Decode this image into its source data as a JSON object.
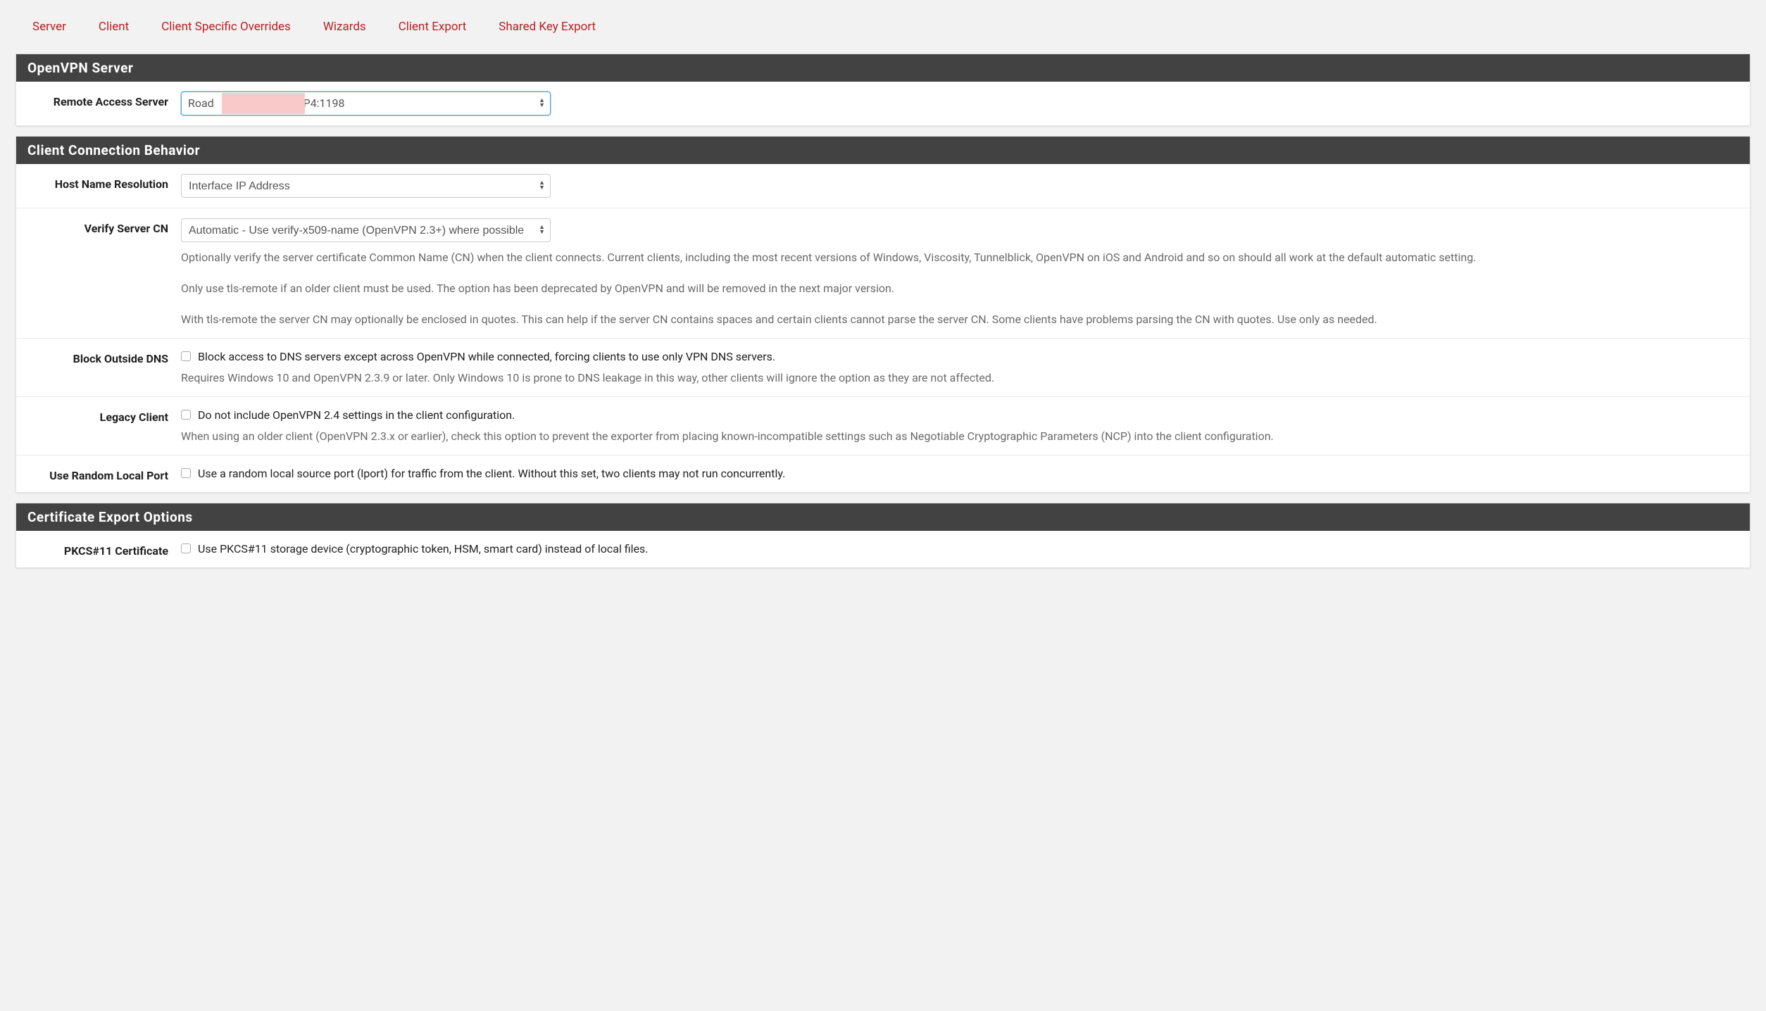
{
  "tabs": [
    {
      "label": "Server"
    },
    {
      "label": "Client"
    },
    {
      "label": "Client Specific Overrides"
    },
    {
      "label": "Wizards"
    },
    {
      "label": "Client Export"
    },
    {
      "label": "Shared Key Export"
    }
  ],
  "panels": {
    "server": {
      "title": "OpenVPN Server",
      "rows": {
        "remote_access": {
          "label": "Remote Access Server",
          "value_prefix": "Road",
          "value_suffix": "UDP4:1198"
        }
      }
    },
    "client_behavior": {
      "title": "Client Connection Behavior",
      "rows": {
        "host_name": {
          "label": "Host Name Resolution",
          "value": "Interface IP Address"
        },
        "verify_cn": {
          "label": "Verify Server CN",
          "value": "Automatic - Use verify-x509-name (OpenVPN 2.3+) where possible",
          "help1": "Optionally verify the server certificate Common Name (CN) when the client connects. Current clients, including the most recent versions of Windows, Viscosity, Tunnelblick, OpenVPN on iOS and Android and so on should all work at the default automatic setting.",
          "help2": "Only use tls-remote if an older client must be used. The option has been deprecated by OpenVPN and will be removed in the next major version.",
          "help3": "With tls-remote the server CN may optionally be enclosed in quotes. This can help if the server CN contains spaces and certain clients cannot parse the server CN. Some clients have problems parsing the CN with quotes. Use only as needed."
        },
        "block_dns": {
          "label": "Block Outside DNS",
          "checkbox_label": "Block access to DNS servers except across OpenVPN while connected, forcing clients to use only VPN DNS servers.",
          "help": "Requires Windows 10 and OpenVPN 2.3.9 or later. Only Windows 10 is prone to DNS leakage in this way, other clients will ignore the option as they are not affected."
        },
        "legacy": {
          "label": "Legacy Client",
          "checkbox_label": "Do not include OpenVPN 2.4 settings in the client configuration.",
          "help": "When using an older client (OpenVPN 2.3.x or earlier), check this option to prevent the exporter from placing known-incompatible settings such as Negotiable Cryptographic Parameters (NCP) into the client configuration."
        },
        "random_port": {
          "label": "Use Random Local Port",
          "checkbox_label": "Use a random local source port (lport) for traffic from the client. Without this set, two clients may not run concurrently."
        }
      }
    },
    "cert_export": {
      "title": "Certificate Export Options",
      "rows": {
        "pkcs11": {
          "label": "PKCS#11 Certificate",
          "checkbox_label": "Use PKCS#11 storage device (cryptographic token, HSM, smart card) instead of local files."
        }
      }
    }
  }
}
